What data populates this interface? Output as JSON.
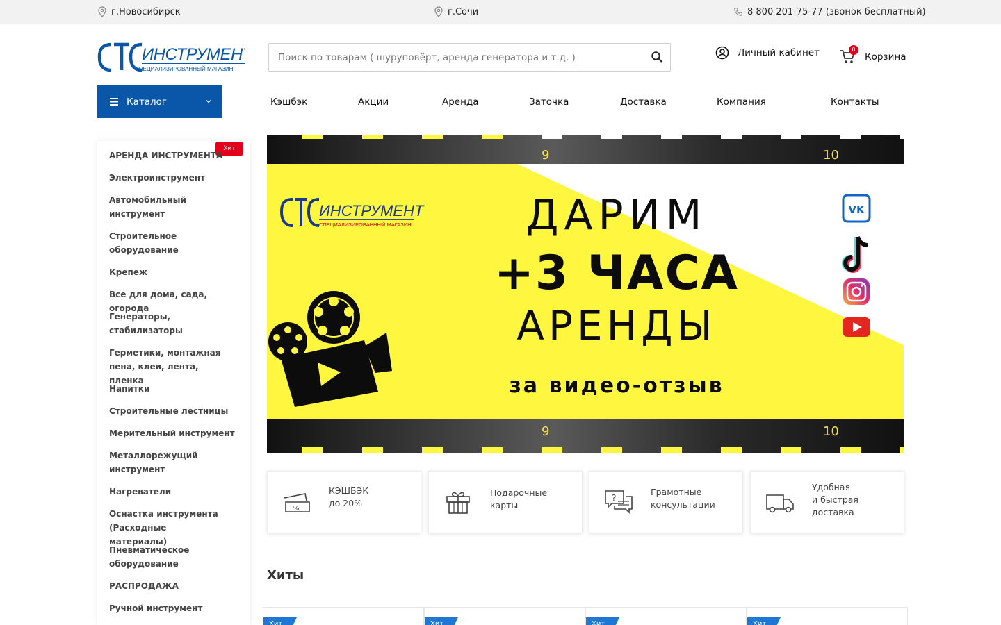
{
  "topbar": {
    "city1": "г.Новосибирск",
    "city2": "г.Сочи",
    "phone": "8 800 201-75-77 (звонок бесплатный)"
  },
  "header": {
    "logo_text": "СТС ИНСТРУМЕНТ",
    "logo_subtext": "СПЕЦИАЛИЗИРОВАННЫЙ МАГАЗИН",
    "search_placeholder": "Поиск по товарам ( шуруповёрт, аренда генератора и т.д. )",
    "account_label": "Личный кабинет",
    "cart_label": "Корзина",
    "cart_count": "0"
  },
  "nav": {
    "catalog_label": "Каталог",
    "links": [
      "Кэшбэк",
      "Акции",
      "Аренда",
      "Заточка",
      "Доставка",
      "Компания",
      "Контакты"
    ]
  },
  "sidebar": {
    "badge": "Хит",
    "items": [
      "АРЕНДА ИНСТРУМЕНТА",
      "Электроинструмент",
      "Автомобильный инструмент",
      "Строительное оборудование",
      "Крепеж",
      "Все для дома, сада, огорода",
      "Генераторы, стабилизаторы",
      "Герметики, монтажная пена, клеи, лента, пленка",
      "Напитки",
      "Строительные лестницы",
      "Мерительный инструмент",
      "Металлорежущий инструмент",
      "Нагреватели",
      "Оснастка инструмента (Расходные материалы)",
      "Пневматическое оборудование",
      "РАСПРОДАЖА",
      "Ручной инструмент"
    ]
  },
  "banner": {
    "line1": "ДАРИМ",
    "line2": "+3 ЧАСА",
    "line3": "АРЕНДЫ",
    "line4": "за видео-отзыв",
    "frame_num_a": "9",
    "frame_num_b": "10",
    "colors": {
      "yellow": "#fef63f",
      "black": "#0c0c0c",
      "logo_blue": "#1b3a8c",
      "logo_red": "#e3001b"
    }
  },
  "features": [
    {
      "line1": "КЭШБЭК",
      "line2": "до 20%",
      "line3": ""
    },
    {
      "line1": "Подарочные",
      "line2": "карты",
      "line3": ""
    },
    {
      "line1": "Грамотные",
      "line2": "консультации",
      "line3": ""
    },
    {
      "line1": "Удобная",
      "line2": "и быстрая",
      "line3": "доставка"
    }
  ],
  "hits": {
    "title": "Хиты",
    "card_badge": "Хит"
  },
  "colors": {
    "accent": "#0a56a8",
    "badge_red": "#e3001b",
    "ribbon_blue": "#1e77d3"
  }
}
